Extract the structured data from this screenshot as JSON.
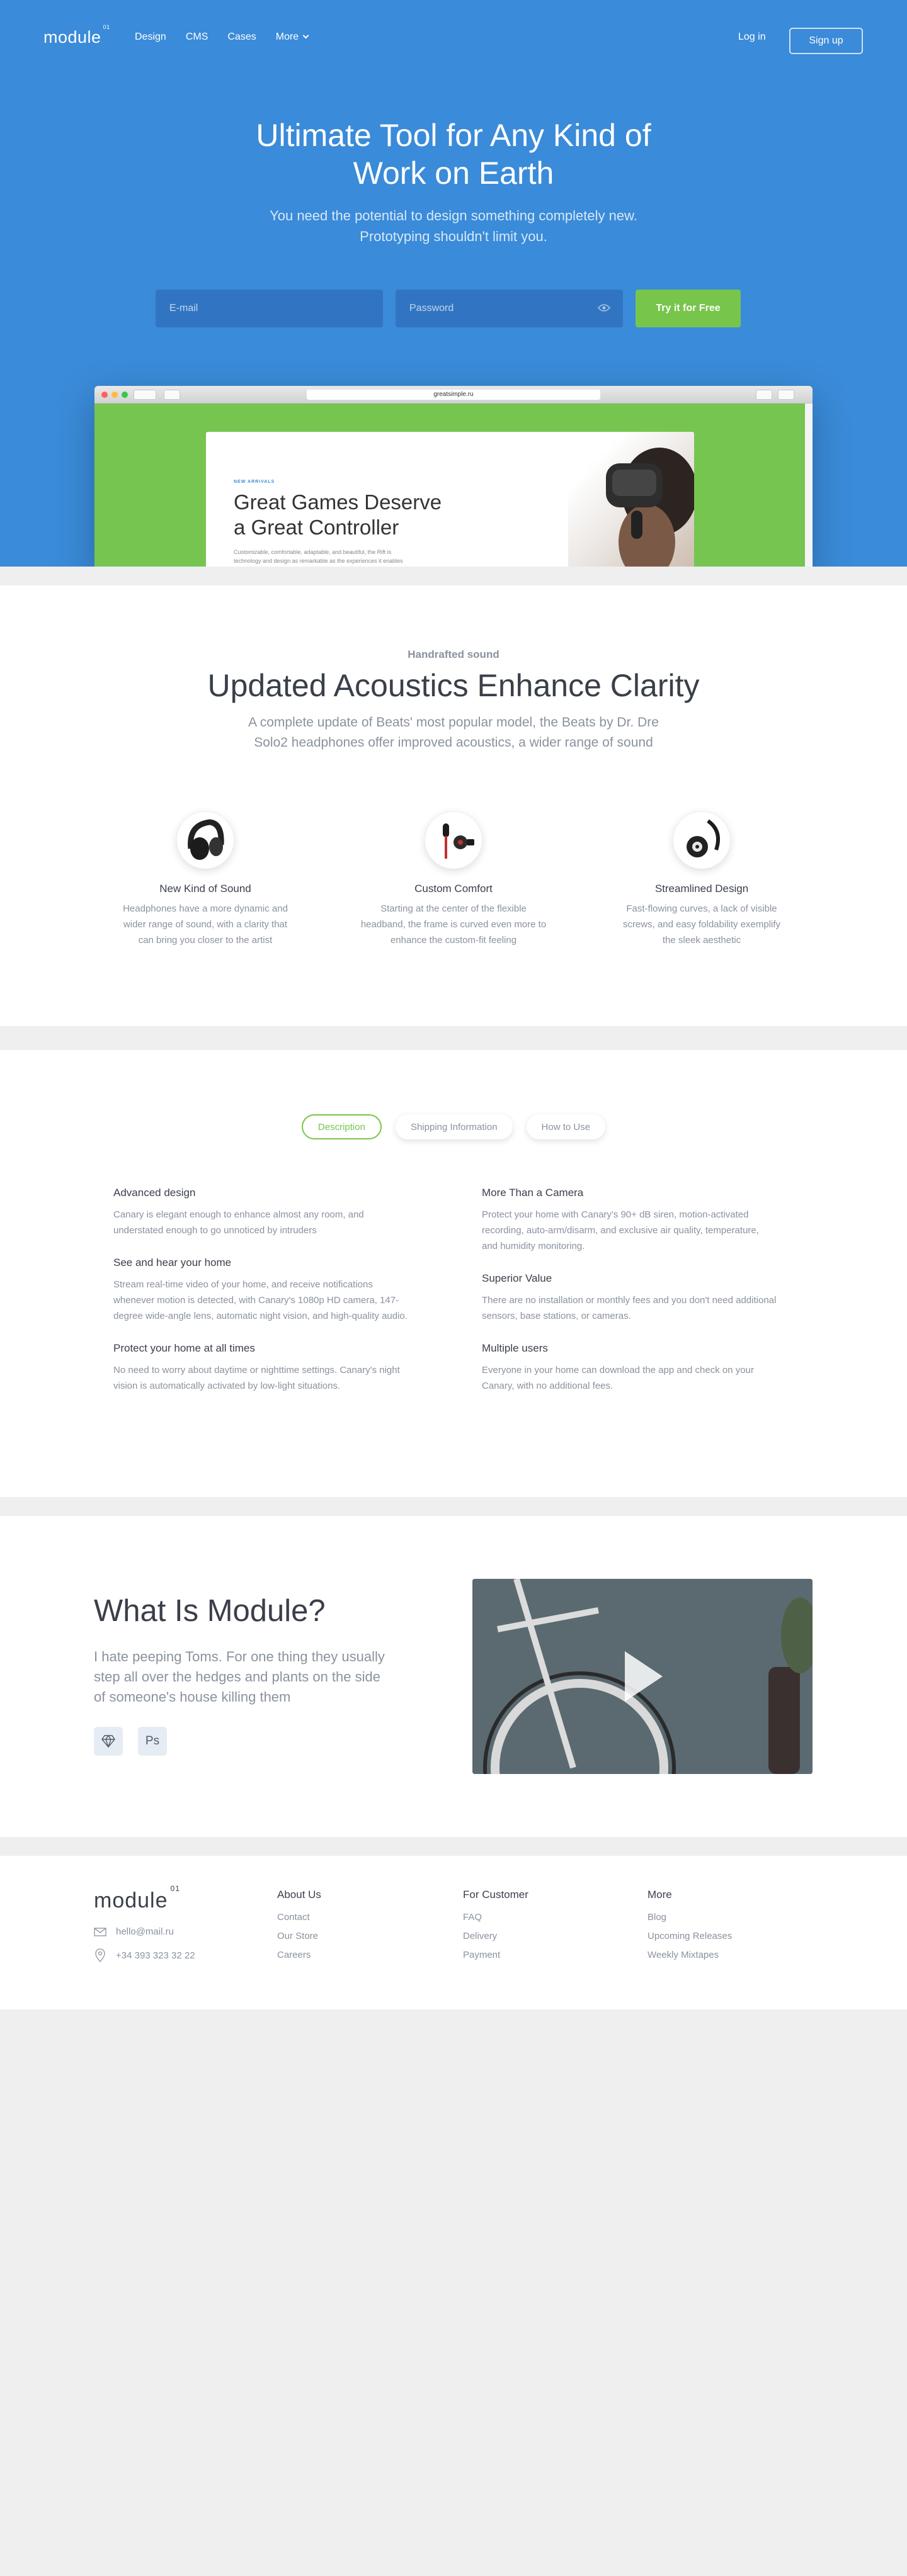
{
  "colors": {
    "primary": "#3a8bd9",
    "accent": "#77c54b",
    "muted": "#8a929e",
    "dark": "#3a3f4a",
    "section_gap": "#efefef"
  },
  "nav": {
    "logo": "module",
    "logo_sup": "01",
    "links": [
      "Design",
      "CMS",
      "Cases",
      "More"
    ],
    "login": "Log in",
    "signup": "Sign up"
  },
  "hero": {
    "title_lines": [
      "Ultimate Tool for Any Kind of",
      "Work on Earth"
    ],
    "subtitle_lines": [
      "You need the potential to design something completely new.",
      "Prototyping shouldn't limit you."
    ],
    "email_placeholder": "E-mail",
    "password_placeholder": "Password",
    "cta": "Try it for Free",
    "browser": {
      "url": "greatsimple.ru",
      "tag": "NEW ARRIVALS",
      "title_lines": [
        "Great Games Deserve",
        "a Great Controller"
      ],
      "text_lines": [
        "Customizable, comfortable, adaptable, and beautiful, the Rift is",
        "technology and design as remarkable as the experiences it enables"
      ]
    }
  },
  "acoustics": {
    "eyebrow": "Handrafted sound",
    "title": "Updated Acoustics Enhance Clarity",
    "subtitle_lines": [
      "A complete update of Beats' most popular model, the Beats by Dr. Dre",
      "Solo2 headphones offer improved acoustics, a wider range of sound"
    ],
    "features": [
      {
        "title": "New Kind of Sound",
        "lines": [
          "Headphones have a more dynamic and",
          "wider range of sound, with a clarity that",
          "can bring you closer to the artist"
        ]
      },
      {
        "title": "Custom Comfort",
        "lines": [
          "Starting at the center of the flexible",
          "headband, the frame is curved even more to",
          "enhance the custom-fit feeling"
        ]
      },
      {
        "title": "Streamlined Design",
        "lines": [
          "Fast-flowing curves, a lack of visible",
          "screws, and easy foldability exemplify",
          "the sleek aesthetic"
        ]
      }
    ]
  },
  "tabs": {
    "items": [
      "Description",
      "Shipping Information",
      "How to Use"
    ],
    "active": 0,
    "left": [
      {
        "title": "Advanced design",
        "lines": [
          "Canary is elegant enough to enhance almost any room, and",
          "understated enough to go unnoticed by intruders"
        ]
      },
      {
        "title": "See and hear your home",
        "lines": [
          "Stream real-time video of your home, and receive notifications",
          "whenever motion is detected, with Canary's 1080p HD camera, 147-",
          "degree wide-angle lens, automatic night vision, and high-quality audio."
        ]
      },
      {
        "title": "Protect your home at all times",
        "lines": [
          "No need to worry about daytime or nighttime settings. Canary's night",
          "vision is automatically activated by low-light situations."
        ]
      }
    ],
    "right": [
      {
        "title": "More Than a Camera",
        "lines": [
          "Protect your home with Canary's 90+ dB siren, motion-activated",
          "recording, auto-arm/disarm, and exclusive air quality, temperature,",
          "and humidity monitoring."
        ]
      },
      {
        "title": "Superior Value",
        "lines": [
          "There are no installation or monthly fees and you don't need additional",
          "sensors, base stations, or cameras."
        ]
      },
      {
        "title": "Multiple users",
        "lines": [
          "Everyone in your home can download the app and check on your",
          "Canary, with no additional fees."
        ]
      }
    ]
  },
  "what": {
    "title": "What Is Module?",
    "text_lines": [
      "I hate peeping Toms. For one thing they usually",
      "step all over the hedges and plants on the side",
      "of someone's house killing them"
    ],
    "icons": [
      "sketch-icon",
      "photoshop-icon"
    ],
    "ps_label": "Ps"
  },
  "footer": {
    "logo": "module",
    "logo_sup": "01",
    "email": "hello@mail.ru",
    "phone": "+34 393 323 32 22",
    "columns": [
      {
        "title": "About Us",
        "links": [
          "Contact",
          "Our Store",
          "Careers"
        ]
      },
      {
        "title": "For Customer",
        "links": [
          "FAQ",
          "Delivery",
          "Payment"
        ]
      },
      {
        "title": "More",
        "links": [
          "Blog",
          "Upcoming Releases",
          "Weekly Mixtapes"
        ]
      }
    ]
  }
}
